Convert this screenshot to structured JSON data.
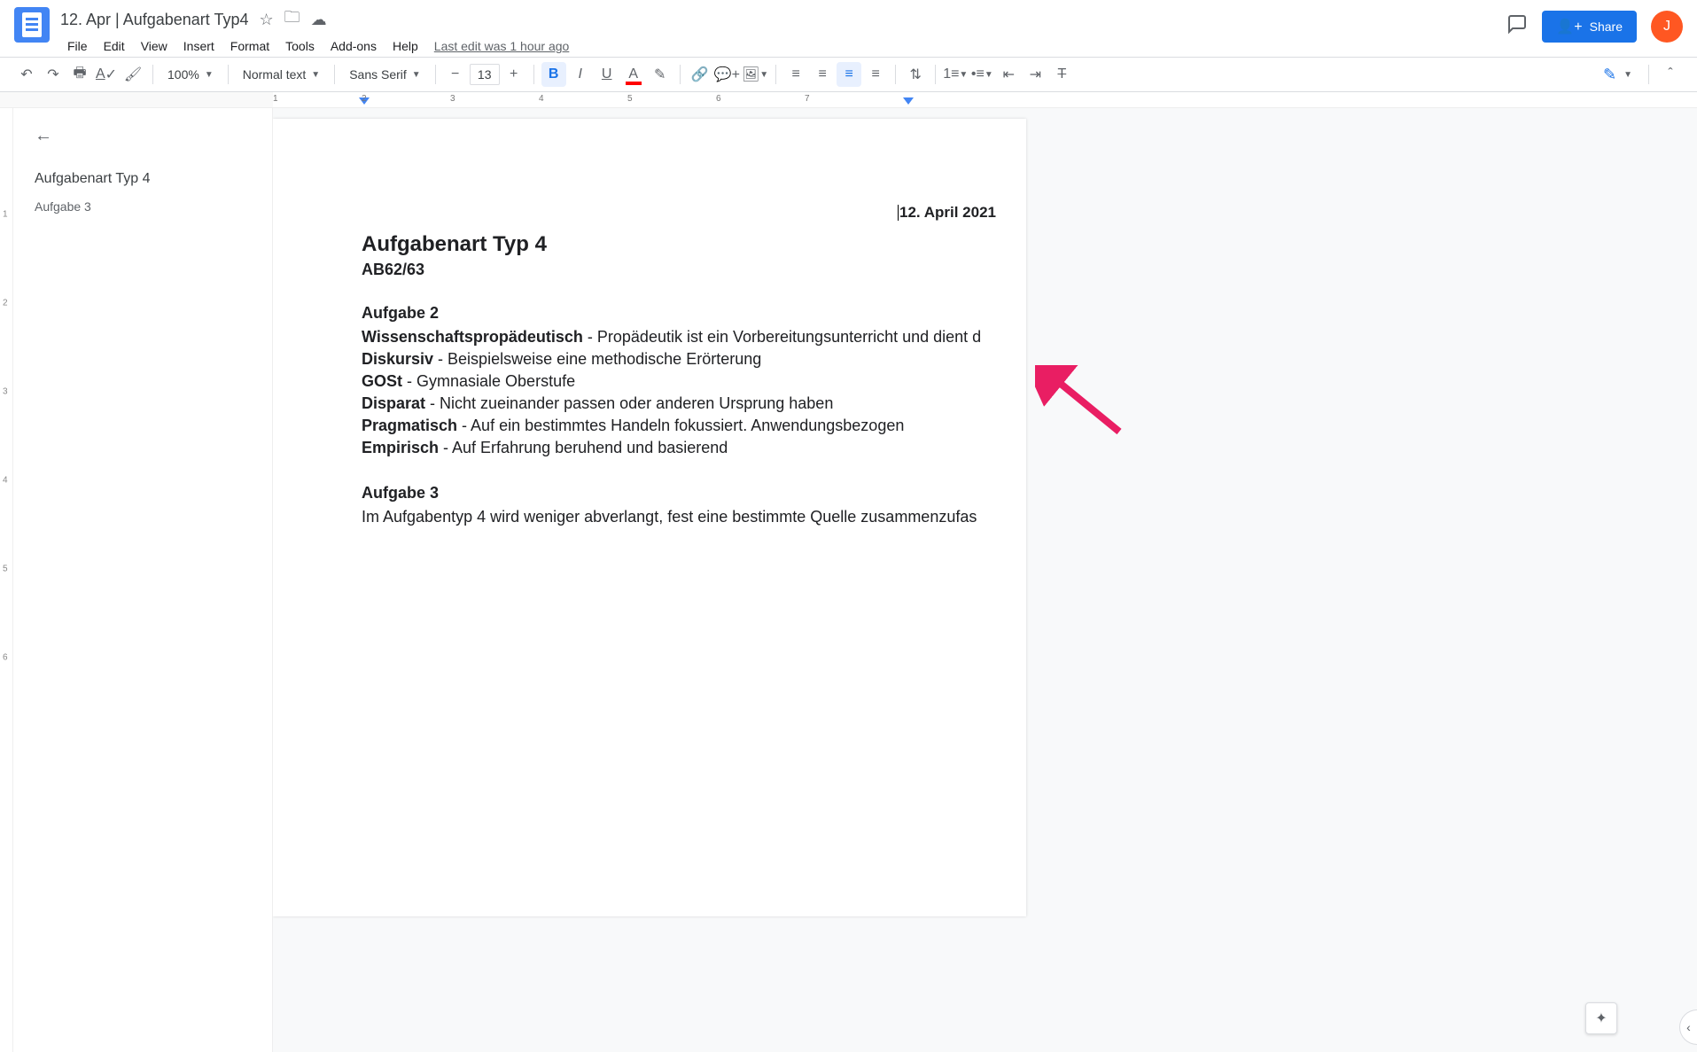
{
  "header": {
    "doc_title": "12. Apr | Aufgabenart Typ4",
    "menus": [
      "File",
      "Edit",
      "View",
      "Insert",
      "Format",
      "Tools",
      "Add-ons",
      "Help"
    ],
    "last_edit": "Last edit was 1 hour ago",
    "share_label": "Share",
    "avatar_letter": "J"
  },
  "toolbar": {
    "zoom": "100%",
    "style": "Normal text",
    "font": "Sans Serif",
    "font_size": "13"
  },
  "ruler": {
    "marks": [
      "1",
      "2",
      "3",
      "4",
      "5",
      "6",
      "7"
    ]
  },
  "outline": {
    "items": [
      {
        "label": "Aufgabenart Typ 4"
      },
      {
        "label": "Aufgabe 3"
      }
    ]
  },
  "doc": {
    "date": "12. April 2021",
    "h1": "Aufgabenart Typ 4",
    "sub": "AB62/63",
    "a2": {
      "title": "Aufgabe 2",
      "lines": [
        {
          "b": "Wissenschaftspropädeutisch",
          "rest": " - Propädeutik ist ein Vorbereitungsunterricht und dient d"
        },
        {
          "b": "Diskursiv",
          "rest": " - Beispielsweise eine methodische Erörterung"
        },
        {
          "b": "GOSt",
          "rest": " - Gymnasiale Oberstufe"
        },
        {
          "b": "Disparat",
          "rest": " - Nicht zueinander passen oder anderen Ursprung haben"
        },
        {
          "b": "Pragmatisch",
          "rest": " - Auf ein bestimmtes Handeln fokussiert. Anwendungsbezogen"
        },
        {
          "b": "Empirisch",
          "rest": " - Auf Erfahrung beruhend und basierend"
        }
      ]
    },
    "a3": {
      "title": "Aufgabe 3",
      "text": "Im Aufgabentyp 4 wird weniger abverlangt, fest eine bestimmte Quelle zusammenzufas"
    }
  },
  "vruler": [
    "1",
    "2",
    "3",
    "4",
    "5",
    "6"
  ]
}
